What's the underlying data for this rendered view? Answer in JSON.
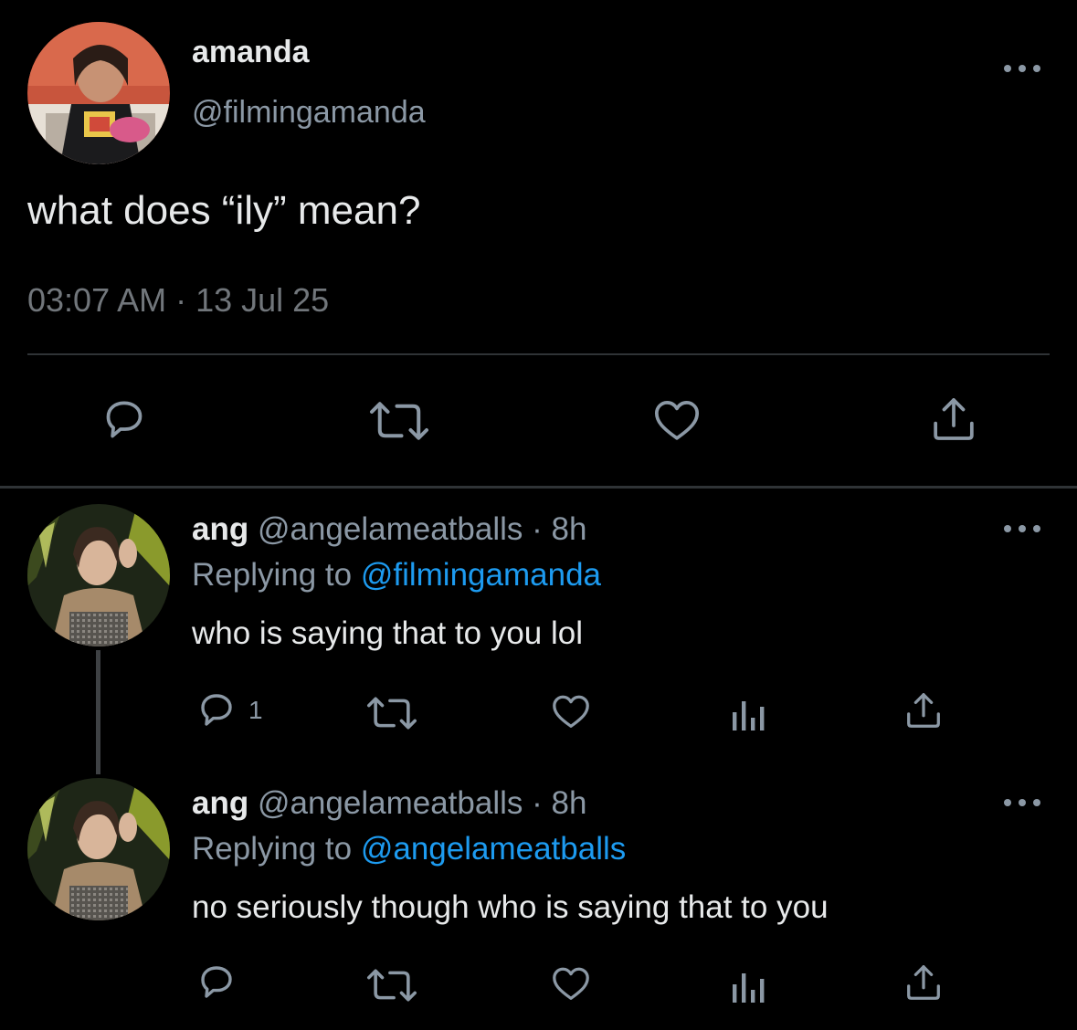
{
  "main_tweet": {
    "display_name": "amanda",
    "handle": "@filmingamanda",
    "text": "what does “ily” mean?",
    "timestamp": "03:07 AM · 13 Jul 25",
    "actions": [
      "reply-icon",
      "retweet-icon",
      "like-icon",
      "share-icon"
    ]
  },
  "replies": [
    {
      "display_name": "ang",
      "handle_time": "@angelameatballs · 8h",
      "replying_prefix": "Replying to",
      "replying_to": "@filmingamanda",
      "text": "who is saying that to you lol",
      "reply_count": "1"
    },
    {
      "display_name": "ang",
      "handle_time": "@angelameatballs · 8h",
      "replying_prefix": "Replying to",
      "replying_to": "@angelameatballs",
      "text": "no seriously though who is saying that to you",
      "reply_count": ""
    }
  ],
  "colors": {
    "background": "#000000",
    "text_primary": "#e7e9ea",
    "text_secondary": "#8b98a5",
    "link": "#1d9bf0",
    "divider": "#2f3336"
  }
}
